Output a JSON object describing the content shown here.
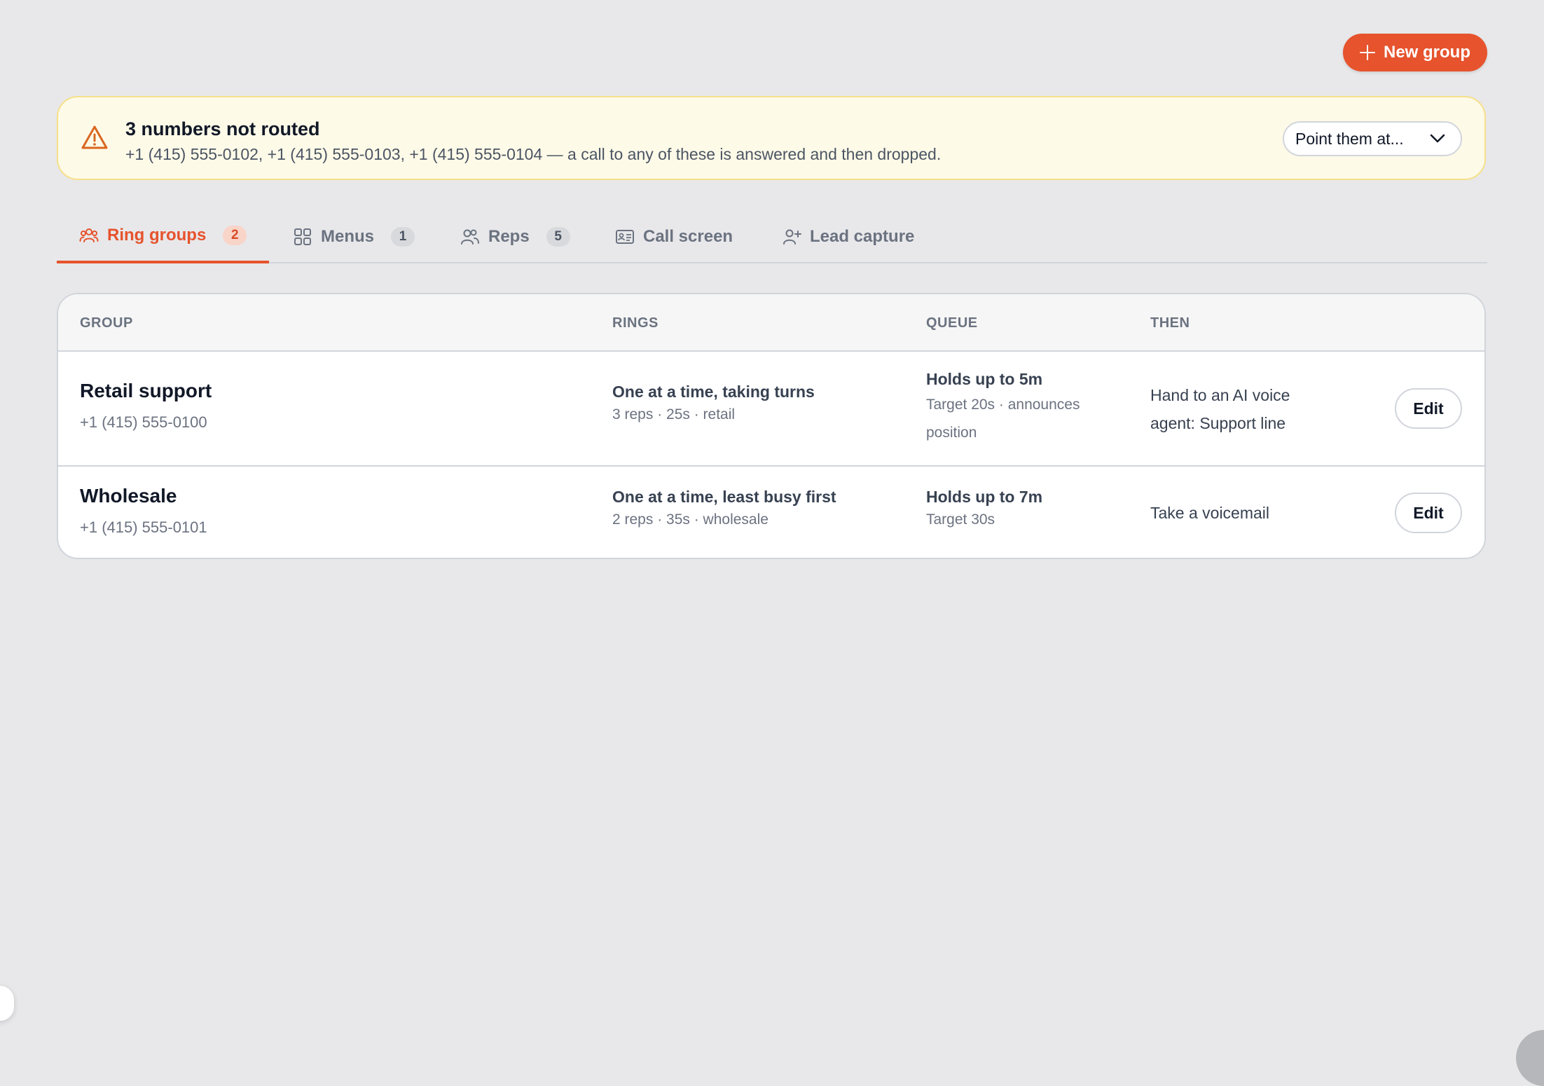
{
  "header": {
    "new_group_label": "New group"
  },
  "alert": {
    "title": "3 numbers not routed",
    "text": "+1 (415) 555-0102, +1 (415) 555-0103, +1 (415) 555-0104 — a call to any of these is answered and then dropped.",
    "select_label": "Point them at..."
  },
  "tabs": [
    {
      "label": "Ring groups",
      "count": "2",
      "icon": "users-icon",
      "active": true
    },
    {
      "label": "Menus",
      "count": "1",
      "icon": "grid-icon",
      "active": false
    },
    {
      "label": "Reps",
      "count": "5",
      "icon": "people-icon",
      "active": false
    },
    {
      "label": "Call screen",
      "count": "",
      "icon": "id-card-icon",
      "active": false
    },
    {
      "label": "Lead capture",
      "count": "",
      "icon": "user-plus-icon",
      "active": false
    }
  ],
  "table": {
    "headers": {
      "group": "GROUP",
      "rings": "RINGS",
      "queue": "QUEUE",
      "then": "THEN"
    },
    "rows": [
      {
        "name": "Retail support",
        "phone": "+1 (415) 555-0100",
        "rings_main": "One at a time, taking turns",
        "rings_sub": "3 reps · 25s · retail",
        "queue_main": "Holds up to 5m",
        "queue_sub_1": "Target 20s · announces",
        "queue_sub_2": "position",
        "then_1": "Hand to an AI voice",
        "then_2": "agent: Support line",
        "edit_label": "Edit"
      },
      {
        "name": "Wholesale",
        "phone": "+1 (415) 555-0101",
        "rings_main": "One at a time, least busy first",
        "rings_sub": "2 reps · 35s · wholesale",
        "queue_main": "Holds up to 7m",
        "queue_sub_1": "Target 30s",
        "then_1": "Take a voicemail",
        "edit_label": "Edit"
      }
    ]
  },
  "colors": {
    "accent": "#e6532d",
    "alert_bg": "#fefae8",
    "alert_border": "#f5e08a",
    "warning_icon": "#d9661f"
  }
}
